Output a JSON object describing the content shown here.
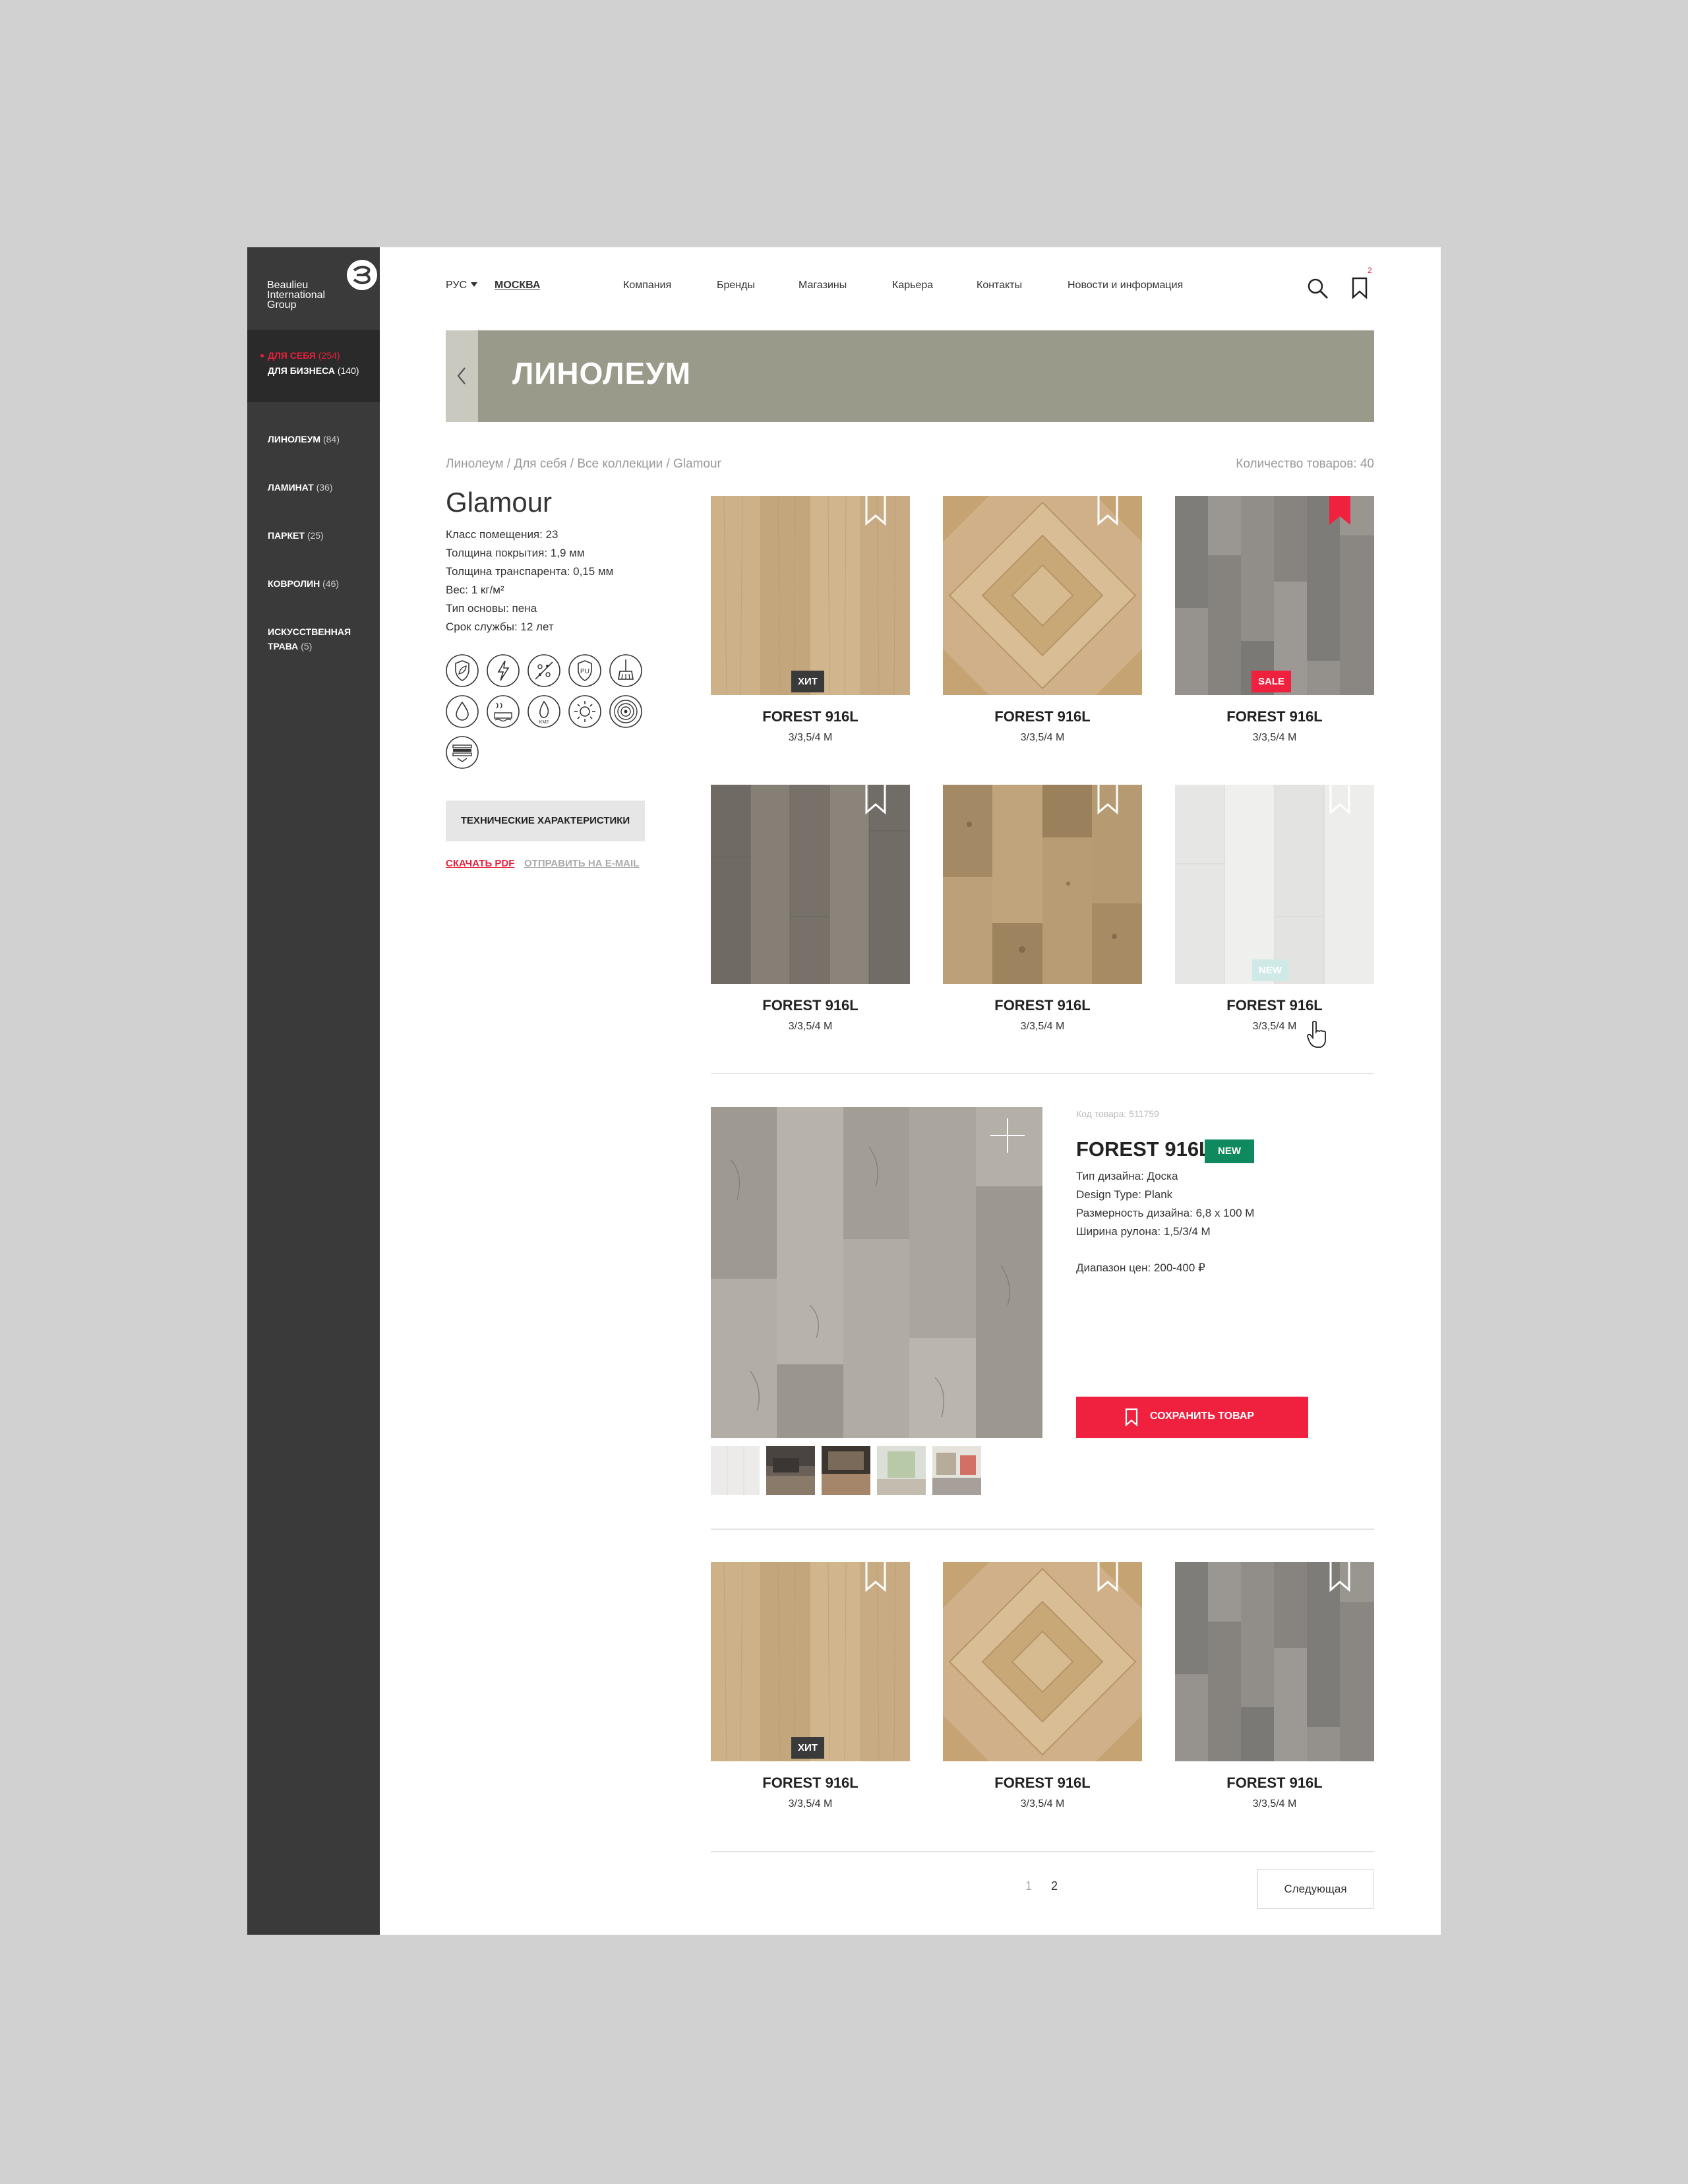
{
  "brand": {
    "line1": "Beaulieu",
    "line2": "International",
    "line3": "Group"
  },
  "audience": [
    {
      "label": "ДЛЯ СЕБЯ",
      "count": "(254)",
      "active": true
    },
    {
      "label": "ДЛЯ БИЗНЕСА",
      "count": "(140)",
      "active": false
    }
  ],
  "categories": [
    {
      "label": "ЛИНОЛЕУМ",
      "count": "(84)"
    },
    {
      "label": "ЛАМИНАТ",
      "count": "(36)"
    },
    {
      "label": "ПАРКЕТ",
      "count": "(25)"
    },
    {
      "label": "КОВРОЛИН",
      "count": "(46)"
    },
    {
      "label": "ИСКУССТВЕННАЯ",
      "label2": "ТРАВА",
      "count": "(5)"
    }
  ],
  "header": {
    "language": "РУС",
    "city": "МОСКВА",
    "nav": [
      "Компания",
      "Бренды",
      "Магазины",
      "Карьера",
      "Контакты",
      "Новости и информация"
    ],
    "bookmarks_count": "2",
    "icons": [
      "search-icon",
      "bookmark-icon"
    ]
  },
  "banner": {
    "title": "ЛИНОЛЕУМ"
  },
  "breadcrumbs": "Линолеум / Для себя / Все коллекции / Glamour",
  "total_items": "Количество товаров: 40",
  "collection": {
    "title": "Glamour",
    "specs": [
      "Класс помещения: 23",
      "Толщина покрытия: 1,9 мм",
      "Толщина транспарента: 0,15 мм",
      "Вес: 1 кг/м²",
      "Тип основы: пена",
      "Срок службы: 12 лет"
    ],
    "property_icons": [
      "eco-shield-icon",
      "antistatic-icon",
      "antibacterial-icon",
      "pu-protection-icon",
      "easy-clean-icon",
      "water-resistant-icon",
      "underfloor-heating-icon",
      "fire-resistant-icon",
      "sun-resistant-icon",
      "wear-rings-icon",
      "sound-insulation-icon"
    ],
    "tech_button": "ТЕХНИЧЕСКИЕ ХАРАКТЕРИСТИКИ",
    "download_pdf": "СКАЧАТЬ PDF",
    "send_email": "ОТПРАВИТЬ НА E-MAIL"
  },
  "products": [
    {
      "name": "FOREST 916L",
      "size": "3/3,5/4 М",
      "tag": "ХИТ",
      "saved": false,
      "swatch": "light-oak"
    },
    {
      "name": "FOREST 916L",
      "size": "3/3,5/4 М",
      "tag": "",
      "saved": false,
      "swatch": "parquet"
    },
    {
      "name": "FOREST 916L",
      "size": "3/3,5/4 М",
      "tag": "SALE",
      "saved": true,
      "swatch": "grey-plank"
    },
    {
      "name": "FOREST 916L",
      "size": "3/3,5/4 М",
      "tag": "",
      "saved": false,
      "swatch": "dark-grey-plank"
    },
    {
      "name": "FOREST 916L",
      "size": "3/3,5/4 М",
      "tag": "",
      "saved": false,
      "swatch": "rustic-oak"
    },
    {
      "name": "FOREST 916L",
      "size": "3/3,5/4 М",
      "tag": "NEW",
      "saved": false,
      "swatch": "white-plank"
    }
  ],
  "detail": {
    "code": "Код товара: 511759",
    "name": "FOREST 916L",
    "badge": "NEW",
    "specs": [
      "Тип дизайна: Доска",
      "Design Type: Plank",
      "Размерность дизайна: 6,8 x 100 M",
      "Ширина рулона: 1,5/3/4 М"
    ],
    "price": "Диапазон цен: 200-400 ₽",
    "save_button": "СОХРАНИТЬ ТОВАР"
  },
  "products_bottom": [
    {
      "name": "FOREST 916L",
      "size": "3/3,5/4 М",
      "tag": "ХИТ",
      "saved": false,
      "swatch": "light-oak"
    },
    {
      "name": "FOREST 916L",
      "size": "3/3,5/4 М",
      "tag": "",
      "saved": false,
      "swatch": "parquet"
    },
    {
      "name": "FOREST 916L",
      "size": "3/3,5/4 М",
      "tag": "",
      "saved": false,
      "swatch": "grey-plank"
    }
  ],
  "pagination": {
    "pages": [
      "1",
      "2"
    ],
    "current": "1",
    "next": "Следующая"
  },
  "colors": {
    "accent": "#f0203f",
    "sidebar": "#3a3a3a",
    "banner": "#9a9a8a",
    "new_badge": "#0f8a5f",
    "hit_badge": "#3a3a3a"
  }
}
